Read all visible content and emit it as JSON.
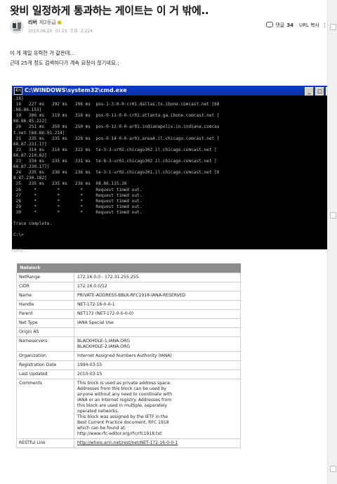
{
  "post": {
    "title": "왓비 일정하게 통과하는 게이트는 이 거 밖에..",
    "author": "리버",
    "grade": "제2등급",
    "date": "2010.08.20",
    "time": "01:23",
    "views_label": "조회",
    "views": "2,224",
    "comment_label": "댓글",
    "comment_count": "34",
    "url_copy_label": "URL 복사",
    "more_label": "⋮",
    "body_line1": "이 게 제일 유력한 거 같은데...",
    "body_line2": "근데 25개 정도 검색하다가 계속 요청이 끊기네요.;"
  },
  "cmd": {
    "title": "C:\\WINDOWS\\system32\\cmd.exe",
    "lines": [
      ".18]",
      " 18   227 ms   292 ms   296 ms  pos-1-3-0-0-cr01.dallas.tx.ibone.comcast.net [68",
      ".86.86.153]",
      " 19   306 ms   319 ms   318 ms  pos-0-11-0-0-cr01.atlanta.ga.ibone.comcast.net [",
      "68.86.85.222]",
      " 20   251 ms   250 ms   250 ms  pos-0-12-0-0-ar01.indianapolis.in.indiana.comcas",
      "t.net [68.86.91.214]",
      " 21   235 ms   235 ms   328 ms  pos-0-14-0-0-ar01.area4.il.chicago.comcast.net [",
      "68.87.231.17]",
      " 22   314 ms   314 ms   322 ms  te-3-3-ur02.chicago302.il.chicago.comcast.net [",
      "68.87.210.82]",
      " 23   334 ms   235 ms   331 ms  te-8-3-ur01.chicago302.il.chicago.comcast.net [",
      "68.87.230.177]",
      " 24   235 ms   236 ms   236 ms  te-3-1-ur02.chicago201.il.chicago.comcast.net [6",
      "8.87.230.182]",
      " 25   235 ms   235 ms   236 ms  68.86.115.26",
      " 26     *        *        *     Request timed out.",
      " 27     *        *        *     Request timed out.",
      " 28     *        *        *     Request timed out.",
      " 29     *        *        *     Request timed out.",
      " 30     *        *        *     Request timed out.",
      "",
      "Trace complete.",
      "",
      "C:\\>"
    ]
  },
  "caption": "가져와...",
  "whois": {
    "header": "Network",
    "rows": [
      {
        "key": "NetRange",
        "value": "172.16.0.0 - 172.31.255.255"
      },
      {
        "key": "CIDR",
        "value": "172.16.0.0/12"
      },
      {
        "key": "Name",
        "value": "PRIVATE-ADDRESS-BBLK-RFC1918-IANA-RESERVED"
      },
      {
        "key": "Handle",
        "value": "NET-172-16-0-0-1"
      },
      {
        "key": "Parent",
        "value": "NET172 (NET-172-0-0-0-0)"
      },
      {
        "key": "Net Type",
        "value": "IANA Special Use"
      },
      {
        "key": "Origin AS",
        "value": ""
      },
      {
        "key": "Nameservers",
        "value": "BLACKHOLE-1.IANA.ORG\nBLACKHOLE-2.IANA.ORG"
      },
      {
        "key": "Organization",
        "value": "Internet Assigned Numbers Authority (IANA)"
      },
      {
        "key": "Registration Date",
        "value": "1994-03-15"
      },
      {
        "key": "Last Updated",
        "value": "2010-03-15"
      },
      {
        "key": "Comments",
        "value": "This block is used as private address space.\nAddresses from this block can be used by\nanyone without any need to coordinate with\nIANA or an Internet registry. Addresses from\nthis block are used in multiple, separately\noperated networks.\nThis block was assigned by the IETF in the\nBest Current Practice document, RFC 1918\nwhich can be found at:\nhttp://www.rfc-editor.org/rfc/rfc1918.txt"
      },
      {
        "key": "RESTful Link",
        "value": "http://whois.arin.net/rest/net/NET-172-16-0-0-1"
      }
    ]
  }
}
